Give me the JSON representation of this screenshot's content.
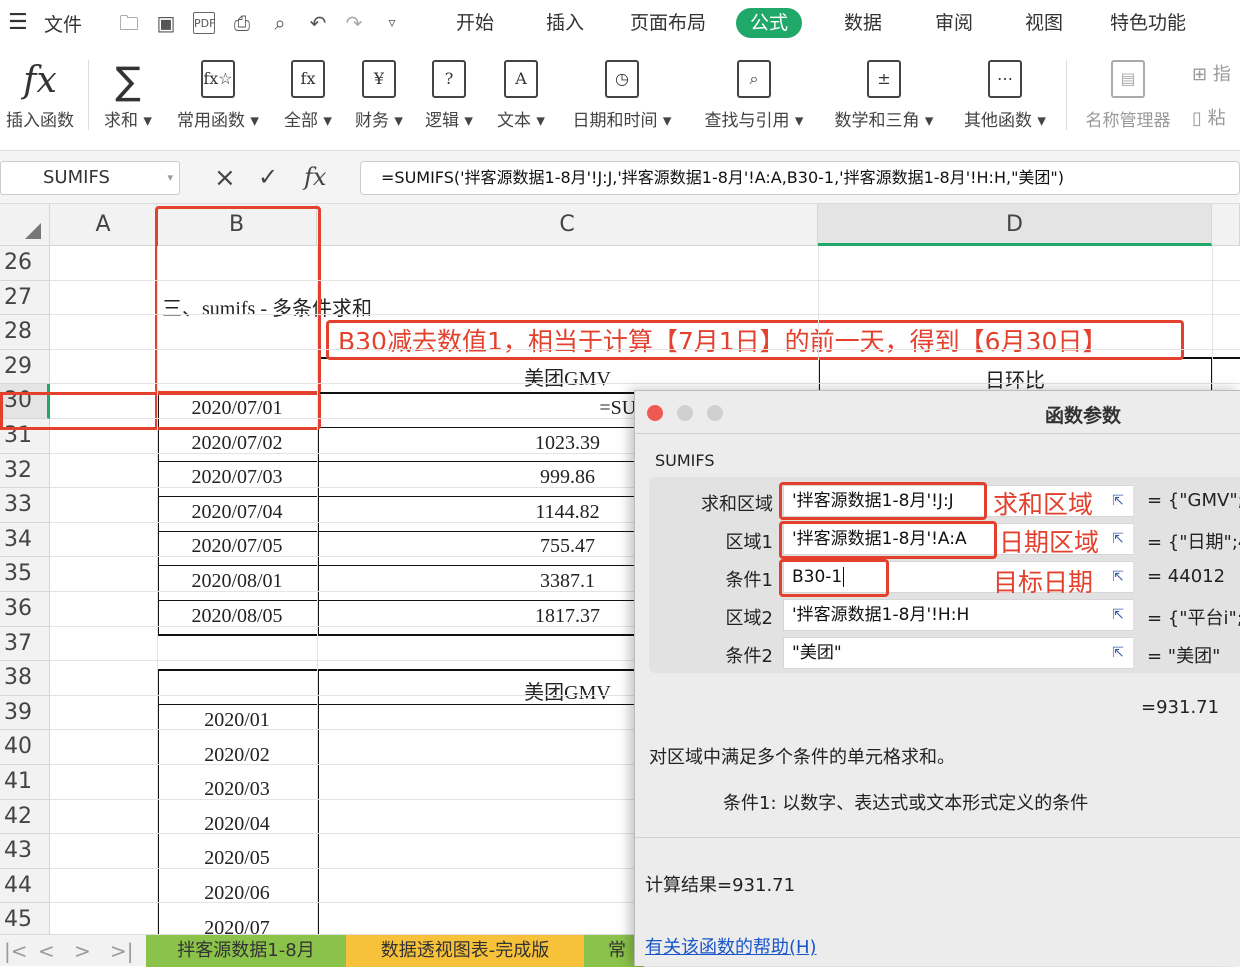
{
  "menubar": {
    "hamburger_label": "文件",
    "tabs": [
      "开始",
      "插入",
      "页面布局",
      "公式",
      "数据",
      "审阅",
      "视图",
      "特色功能"
    ],
    "active_tab": "公式"
  },
  "ribbon": {
    "insert_function": "插入函数",
    "sum": "求和",
    "common": "常用函数",
    "all": "全部",
    "finance": "财务",
    "logic": "逻辑",
    "text": "文本",
    "datetime": "日期和时间",
    "lookup": "查找与引用",
    "math": "数学和三角",
    "other": "其他函数",
    "name_manager": "名称管理器",
    "right1": "指",
    "right2": "粘"
  },
  "formula_bar": {
    "name_box": "SUMIFS",
    "cancel": "×",
    "confirm": "✓",
    "fx": "fx",
    "formula": "=SUMIFS('拌客源数据1-8月'!J:J,'拌客源数据1-8月'!A:A,B30-1,'拌客源数据1-8月'!H:H,\"美团\")"
  },
  "columns": [
    "A",
    "B",
    "C",
    "D"
  ],
  "rows": [
    "26",
    "27",
    "28",
    "29",
    "30",
    "31",
    "32",
    "33",
    "34",
    "35",
    "36",
    "37",
    "38",
    "39",
    "40",
    "41",
    "42",
    "43",
    "44",
    "45"
  ],
  "cells": {
    "b27_heading": "三、sumifs - 多条件求和",
    "c29": "美团GMV",
    "d29": "日环比",
    "c30": "=SUMI",
    "c38": "美团GMV",
    "dates": [
      "2020/07/01",
      "2020/07/02",
      "2020/07/03",
      "2020/07/04",
      "2020/07/05",
      "2020/08/01",
      "2020/08/05"
    ],
    "values": [
      "",
      "1023.39",
      "999.86",
      "1144.82",
      "755.47",
      "3387.1",
      "1817.37"
    ],
    "months": [
      "2020/01",
      "2020/02",
      "2020/03",
      "2020/04",
      "2020/05",
      "2020/06",
      "2020/07"
    ]
  },
  "annotation": "B30减去数值1，相当于计算【7月1日】的前一天，得到【6月30日】",
  "sheet_tabs": [
    "拌客源数据1-8月",
    "数据透视图表-完成版",
    "常"
  ],
  "dialog": {
    "title": "函数参数",
    "func_name": "SUMIFS",
    "args": [
      {
        "label": "求和区域",
        "value": "'拌客源数据1-8月'!J:J",
        "result": "= {\"GMV\";"
      },
      {
        "label": "区域1",
        "value": "'拌客源数据1-8月'!A:A",
        "result": "= {\"日期\";4"
      },
      {
        "label": "条件1",
        "value": "B30-1",
        "result": "= 44012"
      },
      {
        "label": "区域2",
        "value": "'拌客源数据1-8月'!H:H",
        "result": "= {\"平台i\";"
      },
      {
        "label": "条件2",
        "value": "\"美团\"",
        "result": "= \"美团\""
      }
    ],
    "annot_sum": "求和区域",
    "annot_date": "日期区域",
    "annot_target": "目标日期",
    "formula_result": "=931.71",
    "description": "对区域中满足多个条件的单元格求和。",
    "arg_help": "条件1: 以数字、表达式或文本形式定义的条件",
    "calc_result": "计算结果=931.71",
    "help_link": "有关该函数的帮助(H)"
  },
  "colors": {
    "accent": "#1fa867",
    "annotation": "#e4402e",
    "sheet_tab_active": "#8bc34a",
    "sheet_tab_2": "#f7c23a",
    "link": "#1a56c8"
  }
}
